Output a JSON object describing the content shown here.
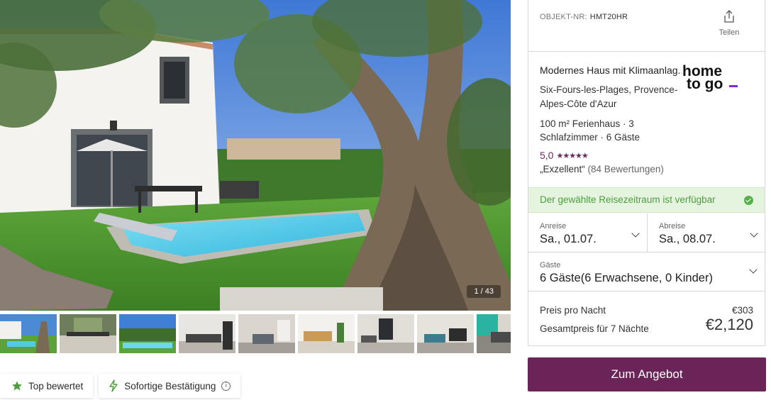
{
  "gallery": {
    "counter": "1 / 43",
    "thumbnails": [
      {
        "name": "thumb-1",
        "desc": "house pool tree"
      },
      {
        "name": "thumb-2",
        "desc": "terrace dining"
      },
      {
        "name": "thumb-3",
        "desc": "garden pool"
      },
      {
        "name": "thumb-4",
        "desc": "kitchen"
      },
      {
        "name": "thumb-5",
        "desc": "living room"
      },
      {
        "name": "thumb-6",
        "desc": "kitchen 2"
      },
      {
        "name": "thumb-7",
        "desc": "open plan"
      },
      {
        "name": "thumb-8",
        "desc": "living area"
      },
      {
        "name": "thumb-9",
        "desc": "terrace"
      }
    ]
  },
  "badges": {
    "top_rated": "Top bewertet",
    "instant_confirm": "Sofortige Bestätigung"
  },
  "listing": {
    "object_label": "OBJEKT-NR:",
    "object_id": "HMT20HR",
    "share_label": "Teilen",
    "title": "Modernes Haus mit Klimaanlag...",
    "location": "Six-Fours-les-Plages, Provence-Alpes-Côte d'Azur",
    "facts": "100 m² Ferienhaus · 3 Schlafzimmer · 6 Gäste",
    "rating_value": "5,0",
    "rating_stars": "★★★★★",
    "rating_word": "„Exzellent“",
    "rating_count": "(84 Bewertungen)",
    "provider_logo_line1": "home",
    "provider_logo_line2": "to go"
  },
  "availability": {
    "text": "Der gewählte Reisezeitraum ist verfügbar"
  },
  "booking": {
    "arrival_label": "Anreise",
    "arrival_value": "Sa., 01.07.",
    "departure_label": "Abreise",
    "departure_value": "Sa., 08.07.",
    "guests_label": "Gäste",
    "guests_value": "6 Gäste(6 Erwachsene, 0 Kinder)"
  },
  "pricing": {
    "per_night_label": "Preis pro Nacht",
    "per_night_value": "€303",
    "total_label": "Gesamtpreis für 7 Nächte",
    "total_value": "€2,120"
  },
  "cta": {
    "label": "Zum Angebot"
  },
  "colors": {
    "brand": "#6b2458",
    "available_bg": "#e4f4df",
    "available_text": "#4d9d3e",
    "rating": "#6a2a5f",
    "star_badge": "#4d9d3e"
  }
}
